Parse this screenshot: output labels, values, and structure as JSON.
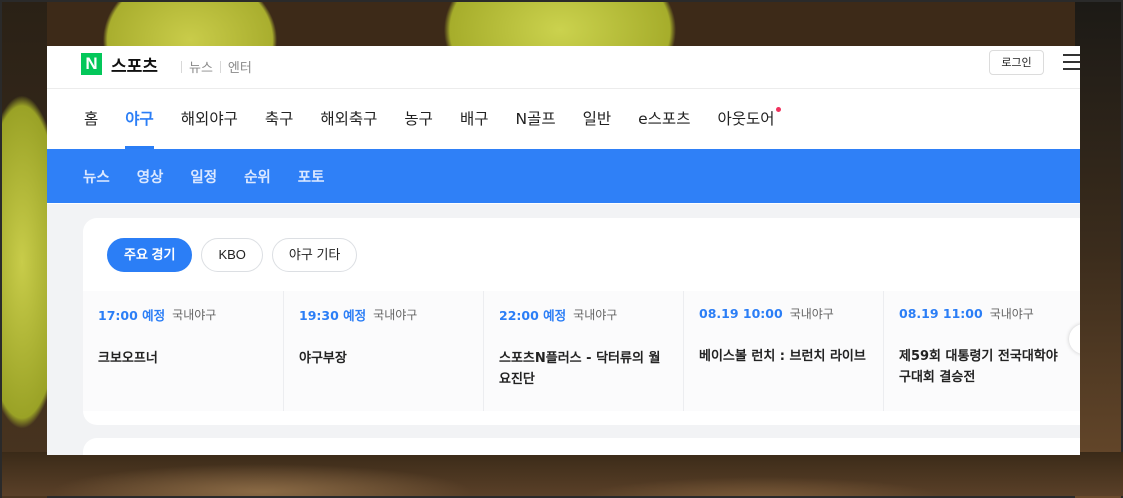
{
  "header": {
    "logo_letter": "N",
    "brand": "스포츠",
    "links": [
      "뉴스",
      "엔터"
    ],
    "login_label": "로그인",
    "menu_icon": "hamburger-menu-icon"
  },
  "categories": [
    {
      "label": "홈",
      "active": false
    },
    {
      "label": "야구",
      "active": true
    },
    {
      "label": "해외야구",
      "active": false
    },
    {
      "label": "축구",
      "active": false
    },
    {
      "label": "해외축구",
      "active": false
    },
    {
      "label": "농구",
      "active": false
    },
    {
      "label": "배구",
      "active": false
    },
    {
      "label": "N골프",
      "active": false
    },
    {
      "label": "일반",
      "active": false
    },
    {
      "label": "e스포츠",
      "active": false
    },
    {
      "label": "아웃도어",
      "active": false,
      "new_dot": true
    }
  ],
  "subnav": [
    "뉴스",
    "영상",
    "일정",
    "순위",
    "포토"
  ],
  "filters": [
    {
      "label": "주요 경기",
      "active": true
    },
    {
      "label": "KBO",
      "active": false
    },
    {
      "label": "야구 기타",
      "active": false
    }
  ],
  "games": [
    {
      "time": "17:00 예정",
      "league": "국내야구",
      "title": "크보오프너"
    },
    {
      "time": "19:30 예정",
      "league": "국내야구",
      "title": "야구부장"
    },
    {
      "time": "22:00 예정",
      "league": "국내야구",
      "title": "스포츠N플러스 - 닥터류의 월요진단"
    },
    {
      "time": "08.19 10:00",
      "league": "국내야구",
      "title": "베이스볼 런치 : 브런치 라이브"
    },
    {
      "time": "08.19 11:00",
      "league": "국내야구",
      "title": "제59회 대통령기 전국대학야구대회 결승전"
    }
  ],
  "colors": {
    "accent": "#2b7ef6",
    "brand_green": "#03c75a",
    "subnav_bg": "#2f80f7",
    "new_dot": "#f0315d"
  }
}
